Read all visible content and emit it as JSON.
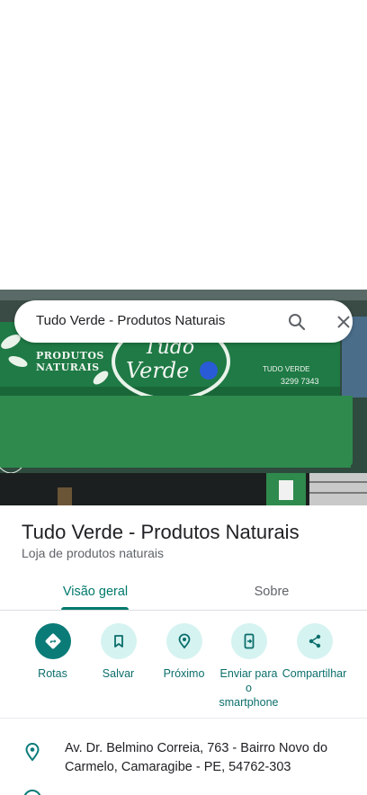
{
  "search": {
    "query": "Tudo Verde - Produtos Naturais"
  },
  "storefront": {
    "sign_left_line1": "PRODUTOS",
    "sign_left_line2": "NATURAIS",
    "logo_line1": "Tudo",
    "logo_line2": "Verde",
    "phone_line1": "TUDO VERDE",
    "phone_line2": "3299 7343"
  },
  "place": {
    "title": "Tudo Verde - Produtos Naturais",
    "category": "Loja de produtos naturais"
  },
  "tabs": [
    {
      "label": "Visão geral",
      "selected": true
    },
    {
      "label": "Sobre",
      "selected": false
    }
  ],
  "actions": [
    {
      "label": "Rotas",
      "icon": "directions-icon"
    },
    {
      "label": "Salvar",
      "icon": "bookmark-icon"
    },
    {
      "label": "Próximo",
      "icon": "nearby-icon"
    },
    {
      "label": "Enviar para o smartphone",
      "icon": "send-to-phone-icon"
    },
    {
      "label": "Compartilhar",
      "icon": "share-icon"
    }
  ],
  "address": {
    "text": "Av. Dr. Belmino Correia, 763 - Bairro Novo do Carmelo, Camaragibe - PE, 54762-303"
  },
  "colors": {
    "accent": "#00796b",
    "action_bg": "#d5f3f1",
    "store_green": "#1f7a45"
  }
}
